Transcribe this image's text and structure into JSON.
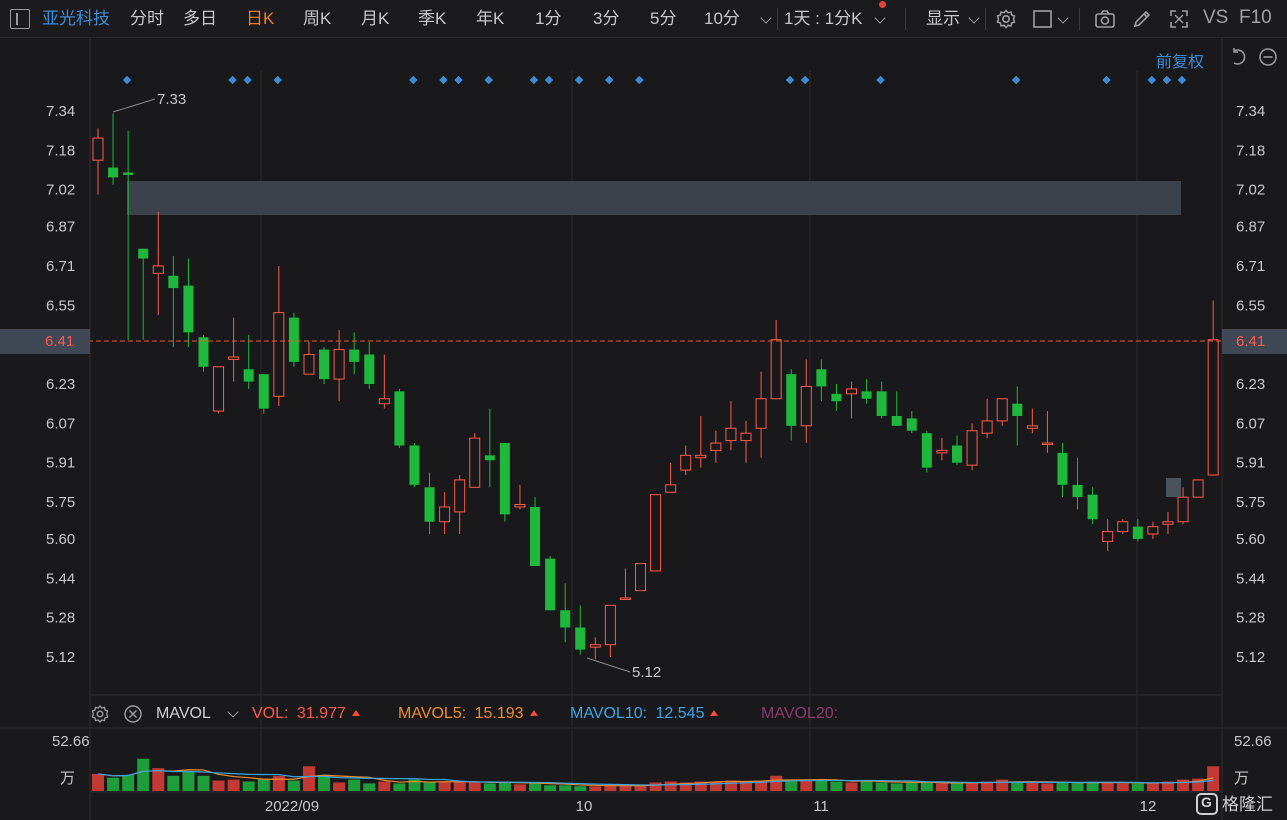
{
  "toolbar": {
    "stock_name": "亚光科技",
    "tabs": [
      "分时",
      "多日",
      "日K",
      "周K",
      "月K",
      "季K",
      "年K",
      "1分",
      "3分",
      "5分",
      "10分"
    ],
    "active_tab": "日K",
    "minute_setting": "1天 : 1分K",
    "display_label": "显示",
    "vs_label": "VS",
    "f10_label": "F10",
    "icons": [
      "settings-icon",
      "layout-icon",
      "camera-icon",
      "pencil-icon",
      "fullscreen-icon"
    ]
  },
  "fuquan": {
    "label": "前复权",
    "icons": [
      "undo-icon",
      "zoom-out-icon"
    ]
  },
  "chart_data": {
    "type": "candlestick",
    "y_ticks": [
      "7.34",
      "7.18",
      "7.02",
      "6.87",
      "6.71",
      "6.55",
      "6.41",
      "6.23",
      "6.07",
      "5.91",
      "5.75",
      "5.60",
      "5.44",
      "5.28",
      "5.12"
    ],
    "current_price": "6.41",
    "high_label": "7.33",
    "low_label": "5.12",
    "date_labels": [
      "2022/09",
      "10",
      "11",
      "12"
    ],
    "candles": [
      [
        7.14,
        7.23,
        7.27,
        7.0
      ],
      [
        7.11,
        7.07,
        7.33,
        7.04
      ],
      [
        7.09,
        7.08,
        7.26,
        6.41
      ],
      [
        6.78,
        6.74,
        6.78,
        6.41
      ],
      [
        6.68,
        6.71,
        6.93,
        6.51
      ],
      [
        6.67,
        6.62,
        6.75,
        6.38
      ],
      [
        6.63,
        6.44,
        6.74,
        6.38
      ],
      [
        6.42,
        6.3,
        6.43,
        6.28
      ],
      [
        6.12,
        6.3,
        6.3,
        6.11
      ],
      [
        6.33,
        6.34,
        6.5,
        6.24
      ],
      [
        6.29,
        6.24,
        6.43,
        6.21
      ],
      [
        6.27,
        6.13,
        6.27,
        6.11
      ],
      [
        6.18,
        6.52,
        6.71,
        6.14
      ],
      [
        6.5,
        6.32,
        6.52,
        6.3
      ],
      [
        6.27,
        6.35,
        6.4,
        6.27
      ],
      [
        6.37,
        6.25,
        6.38,
        6.23
      ],
      [
        6.25,
        6.37,
        6.45,
        6.16
      ],
      [
        6.37,
        6.32,
        6.44,
        6.27
      ],
      [
        6.35,
        6.23,
        6.4,
        6.21
      ],
      [
        6.15,
        6.17,
        6.35,
        6.13
      ],
      [
        6.2,
        5.98,
        6.21,
        5.97
      ],
      [
        5.98,
        5.82,
        5.99,
        5.81
      ],
      [
        5.81,
        5.67,
        5.87,
        5.62
      ],
      [
        5.67,
        5.73,
        5.79,
        5.62
      ],
      [
        5.71,
        5.84,
        5.86,
        5.62
      ],
      [
        5.81,
        6.01,
        6.03,
        5.81
      ],
      [
        5.94,
        5.92,
        6.13,
        5.81
      ],
      [
        5.99,
        5.7,
        5.99,
        5.67
      ],
      [
        5.73,
        5.74,
        5.82,
        5.72
      ],
      [
        5.73,
        5.49,
        5.77,
        5.49
      ],
      [
        5.52,
        5.31,
        5.53,
        5.31
      ],
      [
        5.31,
        5.24,
        5.42,
        5.18
      ],
      [
        5.24,
        5.15,
        5.33,
        5.13
      ],
      [
        5.16,
        5.17,
        5.2,
        5.11
      ],
      [
        5.17,
        5.33,
        5.33,
        5.12
      ],
      [
        5.36,
        5.36,
        5.48,
        5.36
      ],
      [
        5.39,
        5.5,
        5.5,
        5.39
      ],
      [
        5.47,
        5.78,
        5.78,
        5.47
      ],
      [
        5.79,
        5.82,
        5.91,
        5.79
      ],
      [
        5.88,
        5.94,
        5.98,
        5.86
      ],
      [
        5.93,
        5.94,
        6.1,
        5.89
      ],
      [
        5.96,
        5.99,
        6.04,
        5.91
      ],
      [
        6.0,
        6.05,
        6.16,
        5.96
      ],
      [
        6.0,
        6.03,
        6.08,
        5.91
      ],
      [
        6.05,
        6.17,
        6.28,
        5.93
      ],
      [
        6.17,
        6.41,
        6.49,
        6.17
      ],
      [
        6.27,
        6.06,
        6.29,
        6.0
      ],
      [
        6.06,
        6.22,
        6.33,
        5.99
      ],
      [
        6.29,
        6.22,
        6.33,
        6.16
      ],
      [
        6.19,
        6.16,
        6.23,
        6.12
      ],
      [
        6.19,
        6.21,
        6.24,
        6.09
      ],
      [
        6.2,
        6.17,
        6.25,
        6.15
      ],
      [
        6.2,
        6.1,
        6.24,
        6.09
      ],
      [
        6.1,
        6.06,
        6.2,
        6.06
      ],
      [
        6.09,
        6.04,
        6.12,
        6.03
      ],
      [
        6.03,
        5.89,
        6.04,
        5.87
      ],
      [
        5.95,
        5.96,
        6.01,
        5.92
      ],
      [
        5.98,
        5.91,
        6.02,
        5.9
      ],
      [
        5.9,
        6.04,
        6.07,
        5.88
      ],
      [
        6.03,
        6.08,
        6.17,
        6.01
      ],
      [
        6.08,
        6.17,
        6.17,
        6.06
      ],
      [
        6.15,
        6.1,
        6.22,
        5.98
      ],
      [
        6.05,
        6.06,
        6.13,
        6.03
      ],
      [
        5.99,
        5.99,
        6.12,
        5.95
      ],
      [
        5.95,
        5.82,
        5.99,
        5.77
      ],
      [
        5.82,
        5.77,
        5.93,
        5.72
      ],
      [
        5.78,
        5.68,
        5.81,
        5.66
      ],
      [
        5.59,
        5.63,
        5.68,
        5.55
      ],
      [
        5.63,
        5.67,
        5.68,
        5.62
      ],
      [
        5.65,
        5.6,
        5.68,
        5.59
      ],
      [
        5.62,
        5.65,
        5.67,
        5.6
      ],
      [
        5.66,
        5.67,
        5.71,
        5.62
      ],
      [
        5.67,
        5.77,
        5.81,
        5.66
      ],
      [
        5.77,
        5.84,
        5.84,
        5.77
      ],
      [
        5.86,
        6.41,
        6.57,
        5.86
      ]
    ],
    "event_markers": [
      0,
      7,
      8,
      10,
      19,
      21,
      22,
      24,
      27,
      28,
      30,
      32,
      34,
      44,
      45,
      50,
      59,
      65,
      68,
      69,
      70
    ]
  },
  "mavol": {
    "title": "MAVOL",
    "vol_label": "VOL:",
    "vol_value": "31.977",
    "mavol5_label": "MAVOL5:",
    "mavol5_value": "15.193",
    "mavol10_label": "MAVOL10:",
    "mavol10_value": "12.545",
    "mavol20_label": "MAVOL20:",
    "max_label": "52.66",
    "unit_label": "万",
    "colors": {
      "vol": "#ff5a4a",
      "mavol5": "#f08a2a",
      "mavol10": "#3aa6e6",
      "mavol20": "#8a3a6a"
    },
    "volumes": [
      18,
      14,
      17,
      34,
      24,
      16,
      21,
      16,
      11,
      12,
      10,
      13,
      16,
      11,
      26,
      17,
      9,
      12,
      8,
      10,
      8,
      12,
      9,
      10,
      9,
      9,
      8,
      10,
      7,
      8,
      6,
      6,
      5,
      5,
      6,
      6,
      5,
      9,
      10,
      9,
      10,
      10,
      11,
      10,
      11,
      16,
      10,
      12,
      11,
      10,
      9,
      11,
      9,
      8,
      9,
      9,
      8,
      8,
      9,
      10,
      12,
      9,
      9,
      8,
      9,
      9,
      9,
      9,
      8,
      8,
      8,
      10,
      12,
      13,
      26
    ]
  },
  "watermark": "格隆汇"
}
